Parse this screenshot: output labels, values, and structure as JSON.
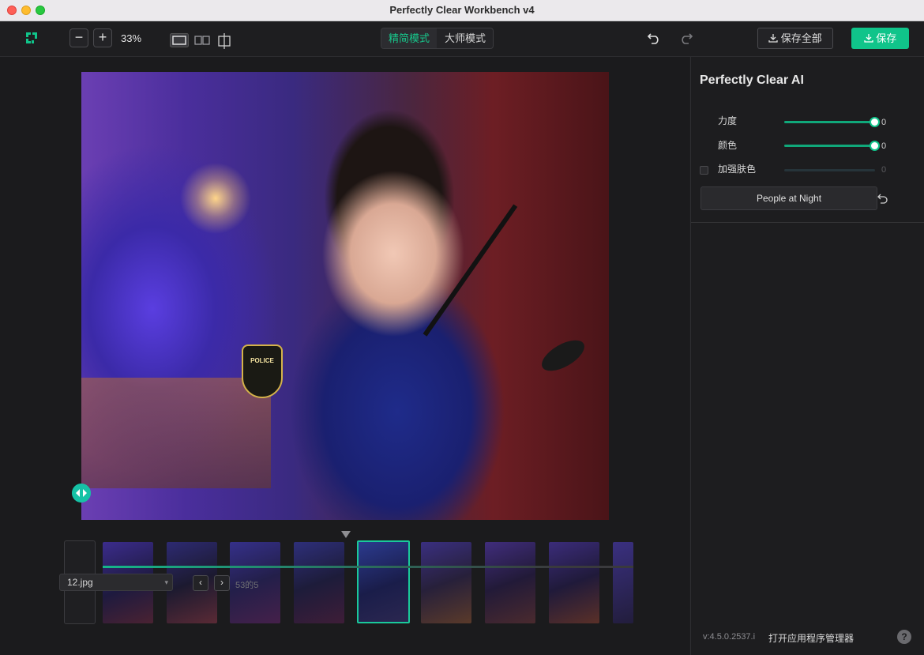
{
  "window": {
    "title": "Perfectly Clear Workbench v4"
  },
  "toolbar": {
    "zoom_out": "−",
    "zoom_in": "+",
    "zoom_level": "33%",
    "mode_simple": "精简模式",
    "mode_master": "大师模式",
    "save_all": "保存全部",
    "save": "保存",
    "accent": "#10c48a"
  },
  "filmstrip": {
    "add": "+",
    "file_name": "12.jpg",
    "prev": "‹",
    "next": "›",
    "count": "53的5"
  },
  "panel": {
    "title": "Perfectly Clear AI",
    "rows": [
      {
        "label": "力度",
        "value": "0",
        "enabled": true,
        "level": 1.0
      },
      {
        "label": "颜色",
        "value": "0",
        "enabled": true,
        "level": 1.0
      },
      {
        "label": "加强肤色",
        "value": "0",
        "enabled": false,
        "level": 0.0
      }
    ],
    "preset": "People at Night",
    "version": "v:4.5.0.2537.i",
    "manager": "打开应用程序管理器",
    "help": "?"
  },
  "photo": {
    "badge_text": "POLICE"
  }
}
